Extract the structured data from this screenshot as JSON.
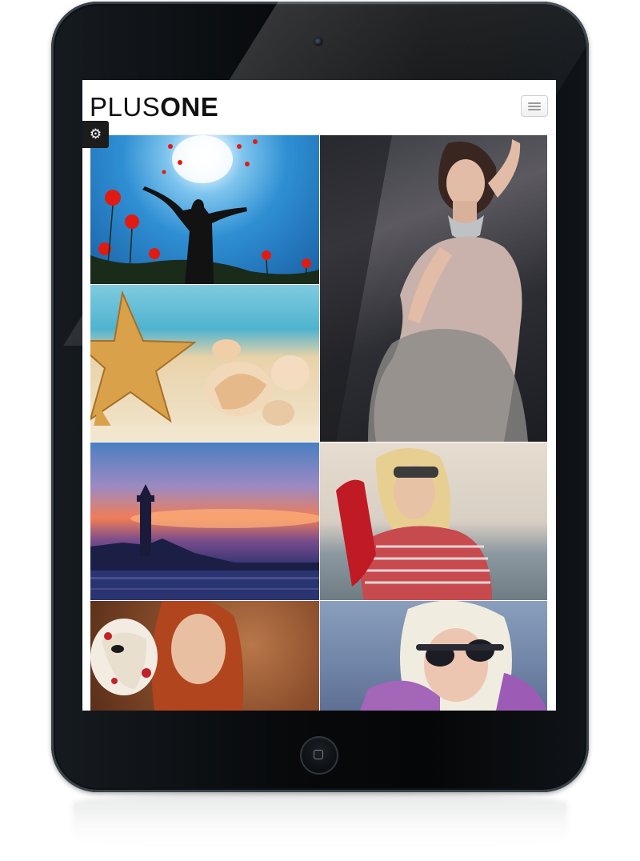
{
  "site": {
    "logo_light": "PLUS",
    "logo_bold": "ONE"
  },
  "icons": {
    "menu": "hamburger-icon",
    "settings": "gear-icon",
    "home_button": "home-button-icon"
  },
  "settings_glyph": "⚙",
  "gallery": [
    {
      "id": "tile-sunset",
      "subject": "silhouette-with-poppies"
    },
    {
      "id": "tile-fashion",
      "subject": "woman-in-satin-dress"
    },
    {
      "id": "tile-beach",
      "subject": "starfish-and-shells"
    },
    {
      "id": "tile-lighthouse",
      "subject": "lighthouse-at-sunset"
    },
    {
      "id": "tile-model-red",
      "subject": "blonde-woman-with-sunglasses-on-head"
    },
    {
      "id": "tile-mask",
      "subject": "redhead-with-venetian-mask"
    },
    {
      "id": "tile-sunglasses",
      "subject": "blonde-woman-with-sunglasses"
    }
  ],
  "colors": {
    "device_body": "#07090b",
    "screen_bg": "#ffffff",
    "logo_text": "#111111",
    "settings_tab_bg": "#1c1c1c"
  }
}
